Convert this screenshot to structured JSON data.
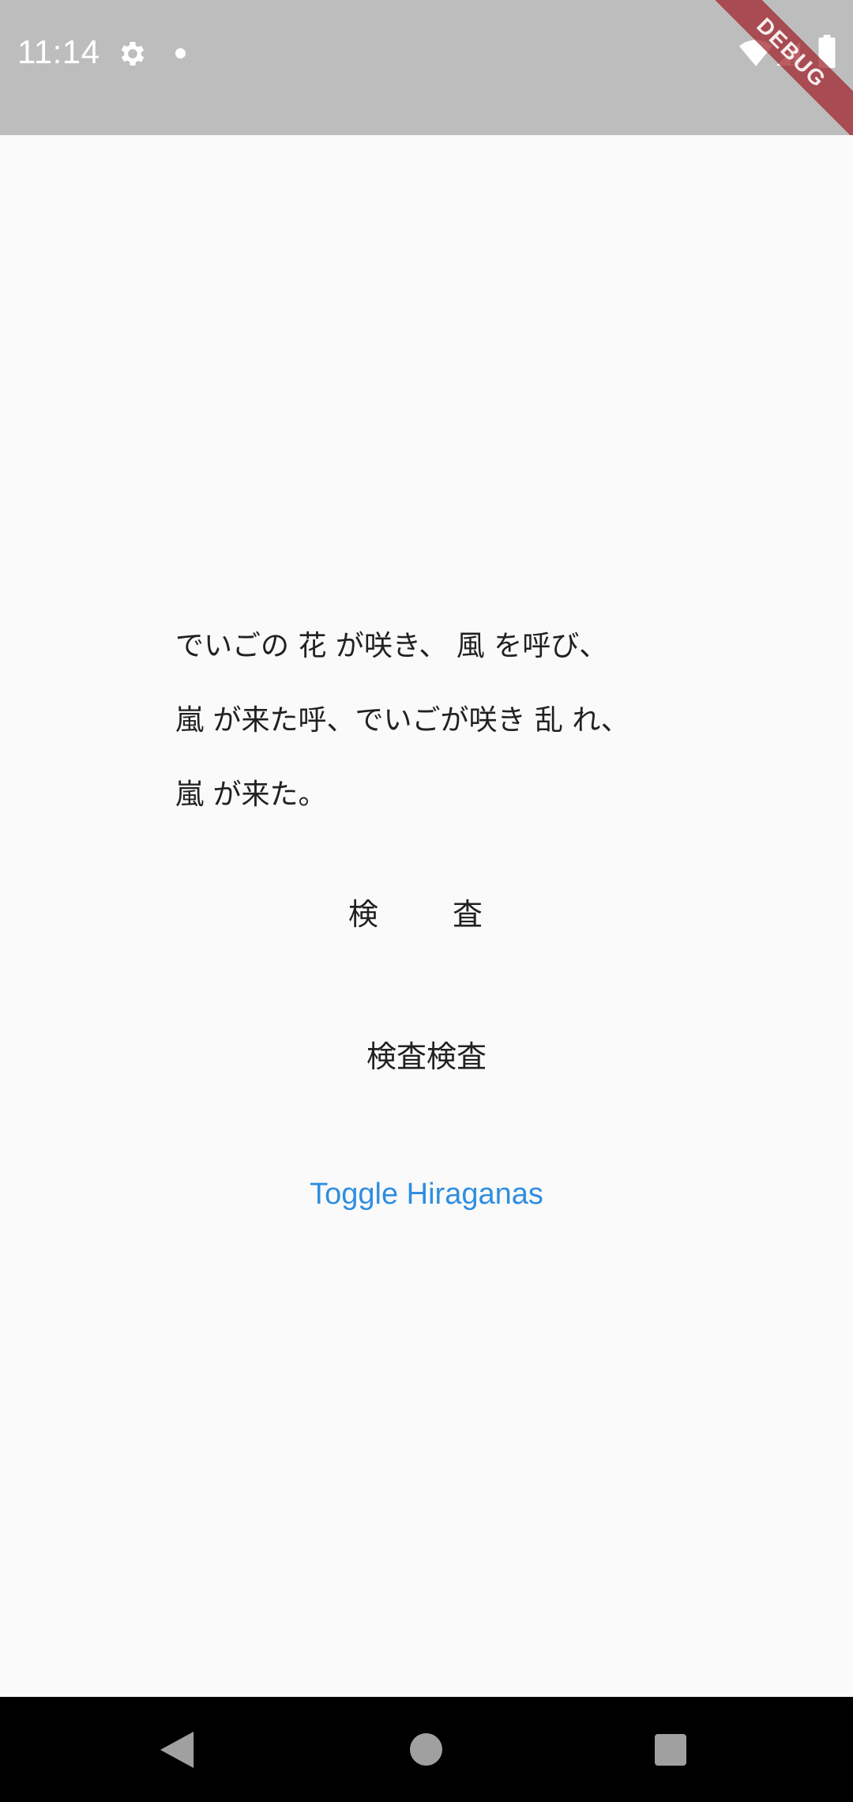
{
  "status_bar": {
    "time": "11:14",
    "icons": [
      "gear-icon",
      "notification-dot-icon",
      "wifi-icon",
      "signal-icon",
      "battery-icon"
    ],
    "background_color": "#bdbdbd"
  },
  "debug_banner": {
    "label": "DEBUG",
    "color": "#a01e28"
  },
  "lyrics": {
    "lines": [
      "でいごの 花 が咲き、 風 を呼び、",
      " 嵐  が来た呼、でいごが咲き 乱 れ、",
      " 嵐  が来た。"
    ]
  },
  "kensa": {
    "spaced": "検　査",
    "plain": "検査検査"
  },
  "toggle_button": {
    "label": "Toggle Hiraganas",
    "color": "#2f8ee0"
  },
  "nav_bar": {
    "icons": [
      "back-icon",
      "home-icon",
      "recents-icon"
    ]
  }
}
